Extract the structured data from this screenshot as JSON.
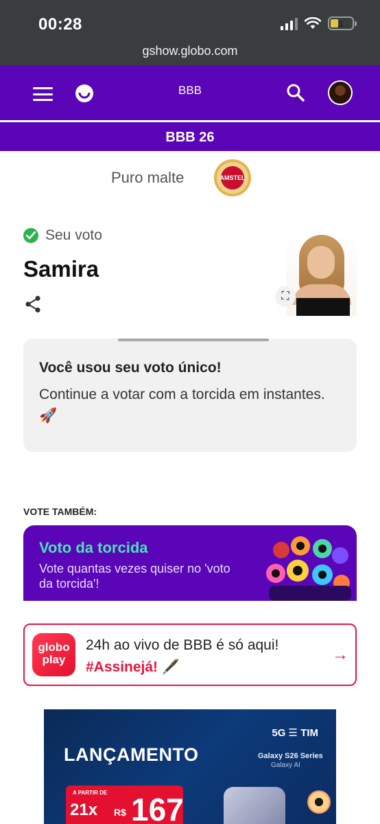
{
  "status_bar": {
    "time": "00:28",
    "battery": "1"
  },
  "browser": {
    "url": "gshow.globo.com"
  },
  "header": {
    "title": "BBB",
    "subtitle": "BBB 26"
  },
  "sponsor": {
    "text": "Puro malte",
    "brand_mark": "AMSTEL"
  },
  "vote": {
    "status": "Seu voto",
    "name": "Samira",
    "status_color": "#2eb34a"
  },
  "notice": {
    "title": "Você usou seu voto único!",
    "text": "Continue a votar com a torcida em instantes. 🚀"
  },
  "vote_also": {
    "label": "VOTE TAMBÉM:",
    "card_title": "Voto da torcida",
    "card_text": "Vote quantas vezes quiser no 'voto da torcida'!"
  },
  "globoplay": {
    "logo": "globo play",
    "line1": "24h ao vivo de BBB é só aqui!",
    "line2": "#Assinejá! 🖋️",
    "arrow": "→"
  },
  "ad": {
    "brand": "5G ☰ TIM",
    "headline": "LANÇAMENTO",
    "model": "Galaxy S26 Series",
    "model_sub": "Galaxy AI",
    "price_from": "A PARTIR DE",
    "installments": "21x",
    "currency": "R$",
    "price": "167"
  },
  "colors": {
    "brand_purple": "#5a05b8",
    "accent_red": "#e5153d",
    "accent_green": "#4be2b5"
  }
}
